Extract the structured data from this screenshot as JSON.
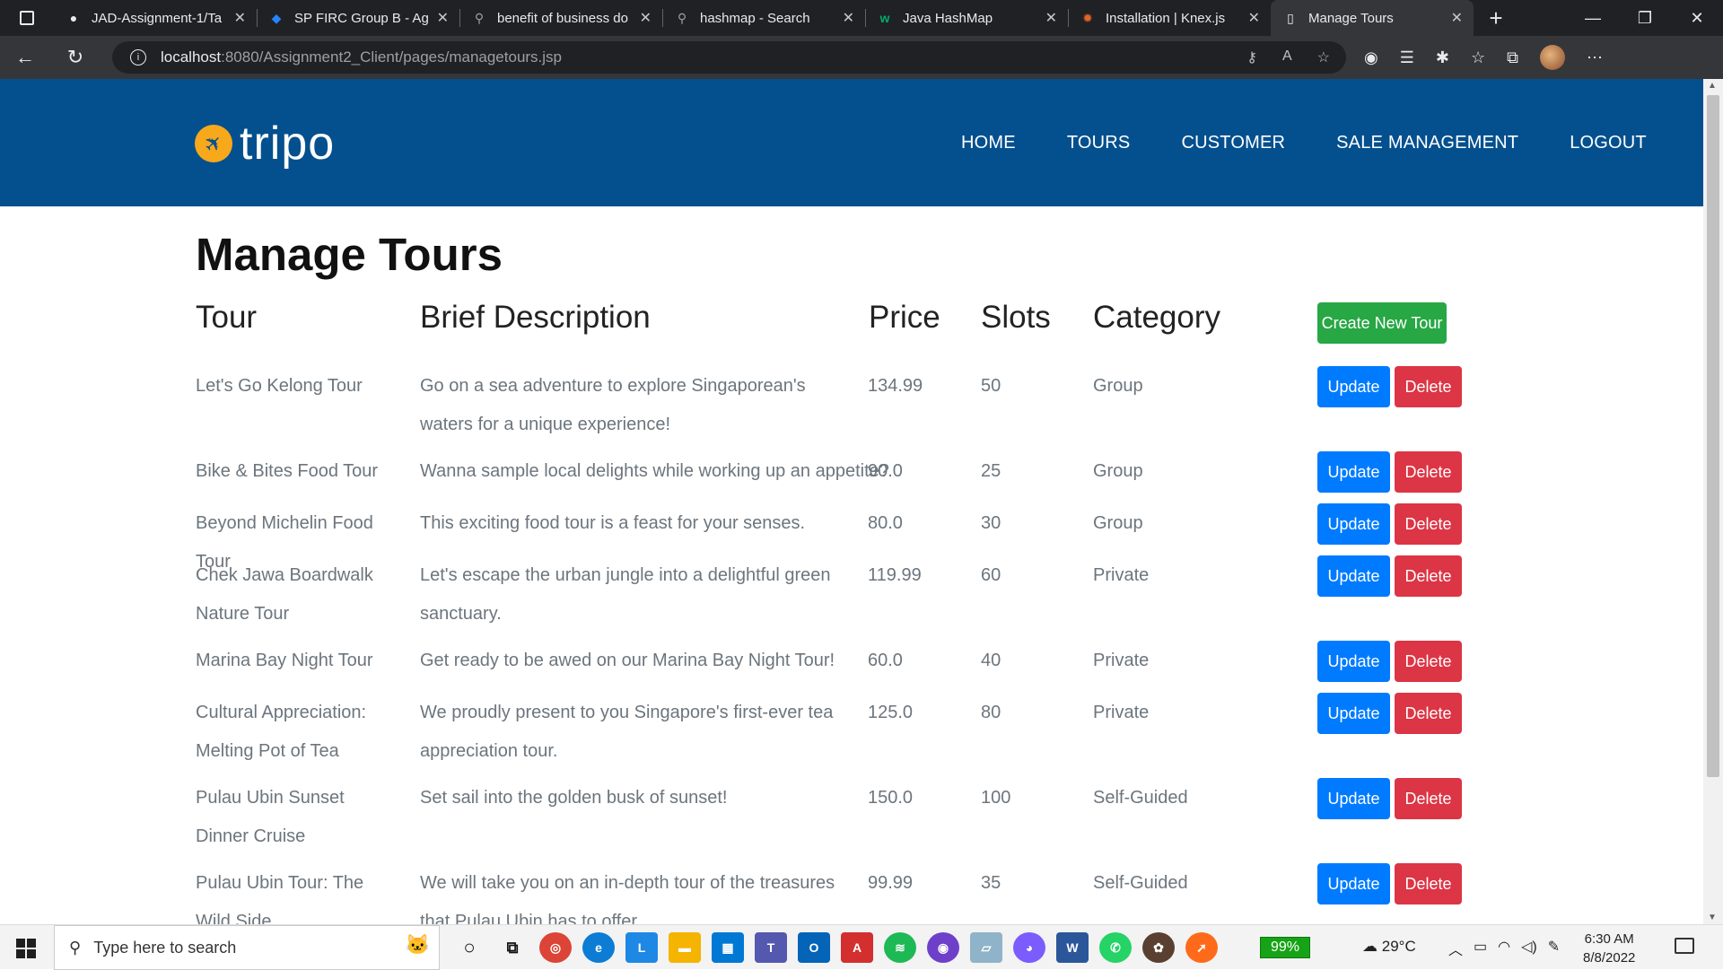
{
  "browser": {
    "tabs": [
      {
        "title": "JAD-Assignment-1/Ta",
        "icon": "github-icon",
        "active": false
      },
      {
        "title": "SP FIRC Group B - Ag",
        "icon": "jira-icon",
        "active": false
      },
      {
        "title": "benefit of business do",
        "icon": "search-icon",
        "active": false
      },
      {
        "title": "hashmap - Search",
        "icon": "search-icon",
        "active": false
      },
      {
        "title": "Java HashMap",
        "icon": "w3schools-icon",
        "active": false
      },
      {
        "title": "Installation | Knex.js",
        "icon": "knex-icon",
        "active": false
      },
      {
        "title": "Manage Tours",
        "icon": "page-icon",
        "active": true
      }
    ],
    "url_host": "localhost",
    "url_path": ":8080/Assignment2_Client/pages/managetours.jsp"
  },
  "site": {
    "logo_text": "tripo",
    "nav": [
      "HOME",
      "TOURS",
      "CUSTOMER",
      "SALE MANAGEMENT",
      "LOGOUT"
    ]
  },
  "main": {
    "title": "Manage Tours",
    "columns": [
      "Tour",
      "Brief Description",
      "Price",
      "Slots",
      "Category"
    ],
    "create_button": "Create New Tour",
    "update_label": "Update",
    "delete_label": "Delete",
    "rows": [
      {
        "tour": "Let's Go Kelong Tour",
        "desc": "Go on a sea adventure to explore Singaporean's waters for a unique experience!",
        "price": "134.99",
        "slots": "50",
        "category": "Group"
      },
      {
        "tour": "Bike & Bites Food Tour",
        "desc": "Wanna sample local delights while working up an appetite?",
        "price": "90.0",
        "slots": "25",
        "category": "Group"
      },
      {
        "tour": "Beyond Michelin Food Tour",
        "desc": "This exciting food tour is a feast for your senses.",
        "price": "80.0",
        "slots": "30",
        "category": "Group"
      },
      {
        "tour": "Chek Jawa Boardwalk Nature Tour",
        "desc": "Let's escape the urban jungle into a delightful green sanctuary.",
        "price": "119.99",
        "slots": "60",
        "category": "Private"
      },
      {
        "tour": "Marina Bay Night Tour",
        "desc": "Get ready to be awed on our Marina Bay Night Tour!",
        "price": "60.0",
        "slots": "40",
        "category": "Private"
      },
      {
        "tour": "Cultural Appreciation: Melting Pot of Tea",
        "desc": "We proudly present to you Singapore's first-ever tea appreciation tour.",
        "price": "125.0",
        "slots": "80",
        "category": "Private"
      },
      {
        "tour": "Pulau Ubin Sunset Dinner Cruise",
        "desc": "Set sail into the golden busk of sunset!",
        "price": "150.0",
        "slots": "100",
        "category": "Self-Guided"
      },
      {
        "tour": "Pulau Ubin Tour: The Wild Side",
        "desc": "We will take you on an in-depth tour of the treasures that Pulau Ubin has to offer",
        "price": "99.99",
        "slots": "35",
        "category": "Self-Guided"
      }
    ]
  },
  "taskbar": {
    "search_placeholder": "Type here to search",
    "battery": "99%",
    "temperature": "29°C",
    "time": "6:30 AM",
    "date": "8/8/2022"
  },
  "colors": {
    "header_bg": "#04508f",
    "logo_accent": "#f7a81b",
    "create_button": "#28a745",
    "update_button": "#007bff",
    "delete_button": "#dc3545"
  }
}
